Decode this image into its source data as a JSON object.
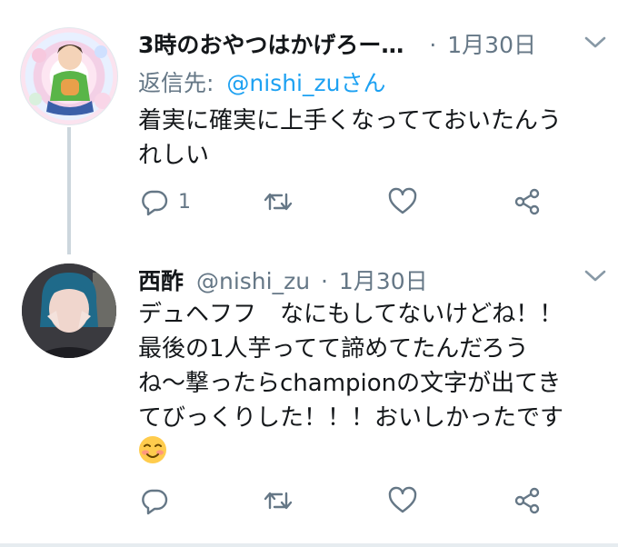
{
  "tweets": [
    {
      "display_name": "3時のおやつはかげろー…",
      "separator": "·",
      "date": "1月30日",
      "reply_prefix": "返信先:",
      "reply_handle": "@nishi_zu",
      "reply_suffix": "さん",
      "text_lines": [
        "着実に確実に上手くなってておいたんう",
        "れしい"
      ],
      "reply_count": "1"
    },
    {
      "display_name": "西酢",
      "handle": "@nishi_zu",
      "separator": "·",
      "date": "1月30日",
      "text_lines": [
        "デュヘフフ　なにもしてないけどね！！",
        "最後の1人芋ってて諦めてたんだろう",
        "ね〜撃ったらchampionの文字が出てき",
        "てびっくりした！！！おいしかったです"
      ],
      "emoji": "smiling-face-with-blush-emoji"
    }
  ],
  "colors": {
    "text": "#14171a",
    "muted": "#657786",
    "thread_line": "#ccd6dd",
    "accent": "#1da1f2"
  },
  "icons": [
    "reply-icon",
    "retweet-icon",
    "like-icon",
    "share-icon",
    "chevron-down-icon"
  ]
}
